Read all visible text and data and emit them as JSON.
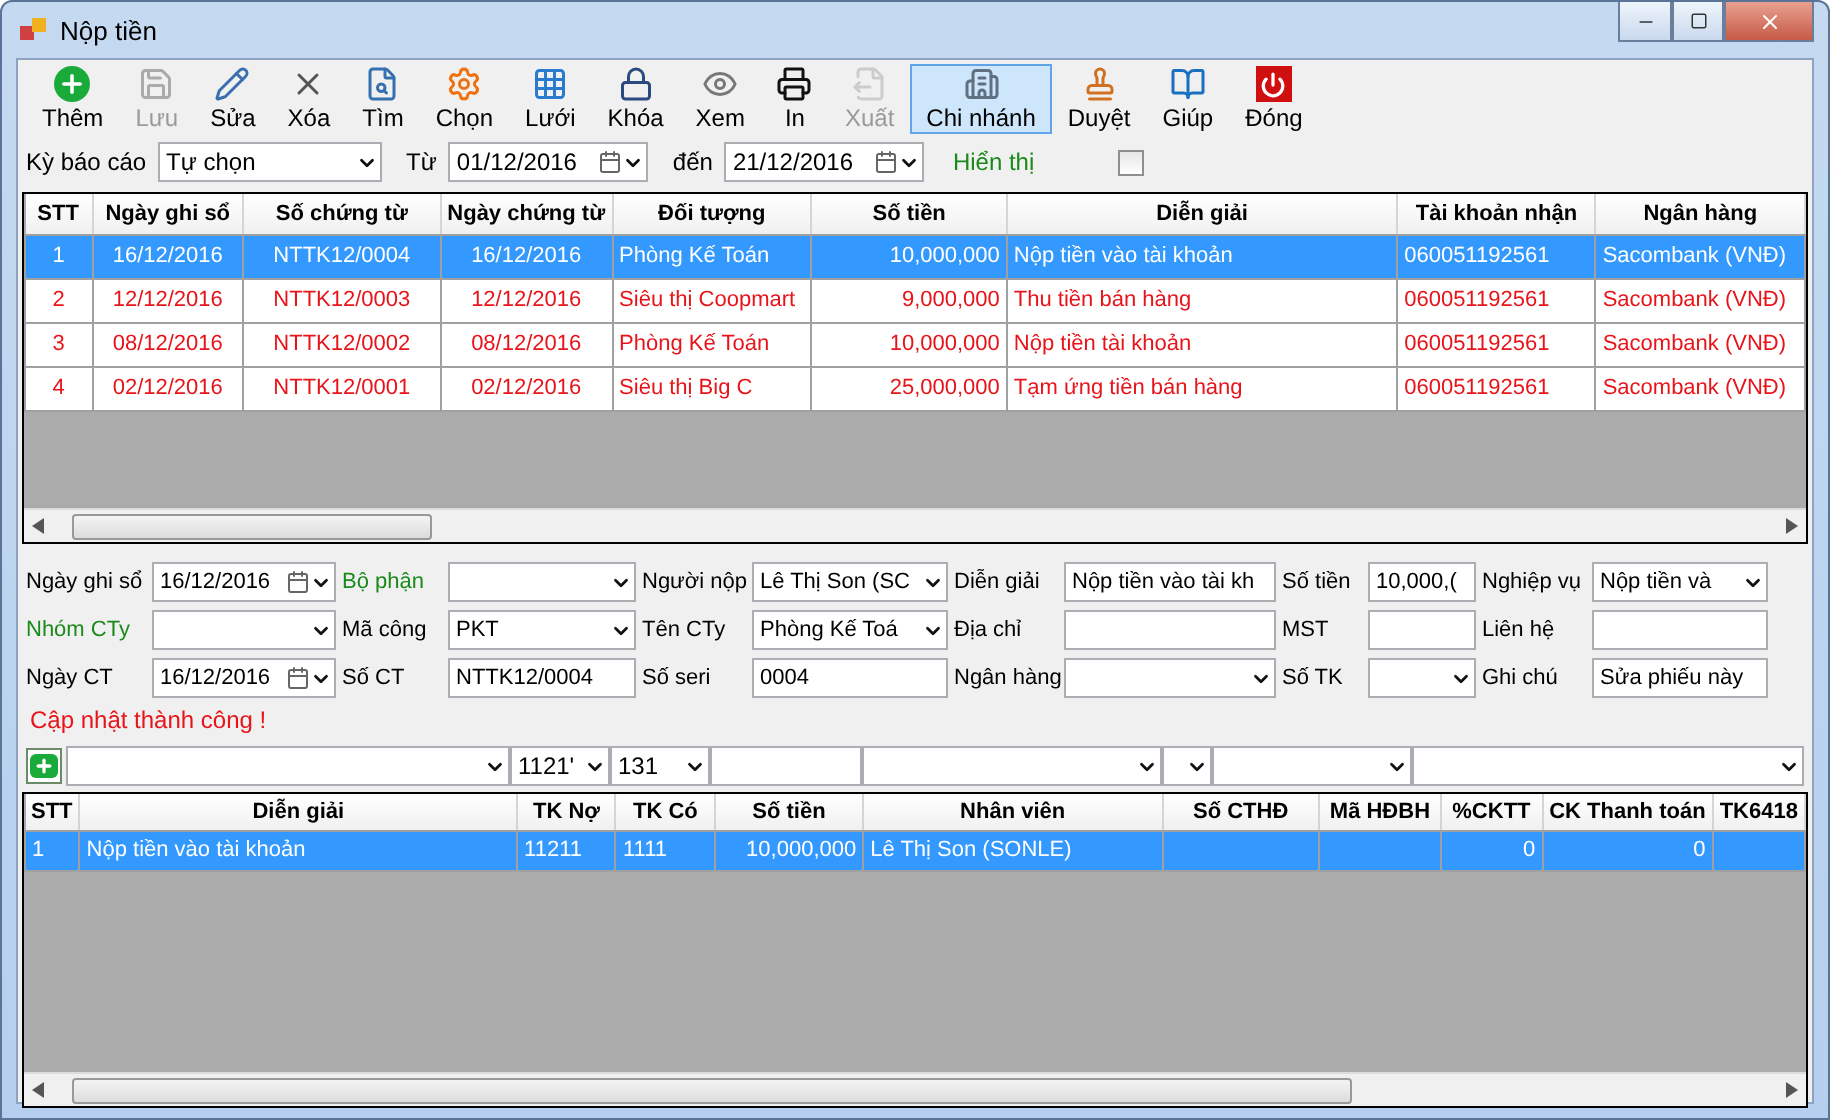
{
  "window": {
    "title": "Nộp tiền"
  },
  "toolbar": [
    {
      "label": "Thêm",
      "enabled": true,
      "selected": false
    },
    {
      "label": "Lưu",
      "enabled": false,
      "selected": false
    },
    {
      "label": "Sửa",
      "enabled": true,
      "selected": false
    },
    {
      "label": "Xóa",
      "enabled": true,
      "selected": false
    },
    {
      "label": "Tìm",
      "enabled": true,
      "selected": false
    },
    {
      "label": "Chọn",
      "enabled": true,
      "selected": false
    },
    {
      "label": "Lưới",
      "enabled": true,
      "selected": false
    },
    {
      "label": "Khóa",
      "enabled": true,
      "selected": false
    },
    {
      "label": "Xem",
      "enabled": true,
      "selected": false
    },
    {
      "label": "In",
      "enabled": true,
      "selected": false
    },
    {
      "label": "Xuất",
      "enabled": false,
      "selected": false
    },
    {
      "label": "Chi nhánh",
      "enabled": true,
      "selected": true
    },
    {
      "label": "Duyệt",
      "enabled": true,
      "selected": false
    },
    {
      "label": "Giúp",
      "enabled": true,
      "selected": false
    },
    {
      "label": "Đóng",
      "enabled": true,
      "selected": false
    }
  ],
  "filter": {
    "period_label": "Kỳ báo cáo",
    "period": "Tự chọn",
    "from_label": "Từ",
    "from": "01/12/2016",
    "to_label": "đến",
    "to": "21/12/2016",
    "show_label": "Hiển thị",
    "show_checked": false
  },
  "table": {
    "columns": [
      "STT",
      "Ngày ghi sổ",
      "Số chứng từ",
      "Ngày chứng từ",
      "Đối tượng",
      "Số tiền",
      "Diễn giải",
      "Tài khoản nhận",
      "Ngân hàng"
    ],
    "rows": [
      {
        "selected": true,
        "cells": [
          "1",
          "16/12/2016",
          "NTTK12/0004",
          "16/12/2016",
          "Phòng Kế Toán",
          "10,000,000",
          "Nộp tiền vào tài khoản",
          "060051192561",
          "Sacombank (VNĐ)"
        ]
      },
      {
        "selected": false,
        "cells": [
          "2",
          "12/12/2016",
          "NTTK12/0003",
          "12/12/2016",
          "Siêu thị Coopmart",
          "9,000,000",
          "Thu tiền bán hàng",
          "060051192561",
          "Sacombank (VNĐ)"
        ]
      },
      {
        "selected": false,
        "cells": [
          "3",
          "08/12/2016",
          "NTTK12/0002",
          "08/12/2016",
          "Phòng Kế Toán",
          "10,000,000",
          "Nộp tiền tài khoản",
          "060051192561",
          "Sacombank (VNĐ)"
        ]
      },
      {
        "selected": false,
        "cells": [
          "4",
          "02/12/2016",
          "NTTK12/0001",
          "02/12/2016",
          "Siêu thị Big C",
          "25,000,000",
          "Tạm ứng tiền bán hàng",
          "060051192561",
          "Sacombank (VNĐ)"
        ]
      }
    ]
  },
  "form": [
    [
      {
        "label": "Ngày ghi sổ",
        "linked": false,
        "kind": "date",
        "value": "16/12/2016"
      },
      {
        "label": "Bộ phận",
        "linked": true,
        "kind": "combo"
      },
      {
        "label": "Người nộp",
        "linked": false,
        "kind": "combo",
        "value": "Lê Thị Son (SC"
      },
      {
        "label": "Diễn giải",
        "linked": false,
        "kind": "text",
        "value": "Nộp tiền vào tài kh"
      },
      {
        "label": "Số tiền",
        "linked": false,
        "kind": "text",
        "value": "10,000,("
      },
      {
        "label": "Nghiệp vụ",
        "linked": false,
        "kind": "combo",
        "value": "Nộp tiền và"
      }
    ],
    [
      {
        "label": "Nhóm CTy",
        "linked": true,
        "kind": "combo"
      },
      {
        "label": "Mã công",
        "linked": false,
        "kind": "combo",
        "value": "PKT"
      },
      {
        "label": "Tên CTy",
        "linked": false,
        "kind": "combo",
        "value": "Phòng Kế Toá"
      },
      {
        "label": "Địa chỉ",
        "linked": false,
        "kind": "text"
      },
      {
        "label": "MST",
        "linked": false,
        "kind": "text"
      },
      {
        "label": "Liên hệ",
        "linked": false,
        "kind": "text"
      }
    ],
    [
      {
        "label": "Ngày CT",
        "linked": false,
        "kind": "date",
        "value": "16/12/2016"
      },
      {
        "label": "Số CT",
        "linked": false,
        "kind": "text",
        "value": "NTTK12/0004"
      },
      {
        "label": "Số seri",
        "linked": false,
        "kind": "text",
        "value": "0004"
      },
      {
        "label": "Ngân hàng",
        "linked": false,
        "kind": "combo"
      },
      {
        "label": "Số TK",
        "linked": false,
        "kind": "combo"
      },
      {
        "label": "Ghi chú",
        "linked": false,
        "kind": "text",
        "value": "Sửa phiếu này"
      }
    ]
  ],
  "status_message": "Cập nhật thành công !",
  "detail_inputs": [
    {
      "kind": "combo"
    },
    {
      "kind": "combo",
      "value": "1121'"
    },
    {
      "kind": "combo",
      "value": "131"
    },
    {
      "kind": "text"
    },
    {
      "kind": "combo"
    },
    {
      "kind": "combo"
    },
    {
      "kind": "combo"
    },
    {
      "kind": "combo"
    }
  ],
  "detail_table": {
    "columns": [
      "STT",
      "Diễn giải",
      "TK Nợ",
      "TK Có",
      "Số tiền",
      "Nhân viên",
      "Số CTHĐ",
      "Mã HĐBH",
      "%CKTT",
      "CK Thanh toán",
      "TK6418"
    ],
    "rows": [
      {
        "selected": true,
        "cells": [
          "1",
          "Nộp tiền vào tài khoản",
          "11211",
          "1111",
          "10,000,000",
          "Lê Thị Son (SONLE)",
          "",
          "",
          "0",
          "0",
          ""
        ]
      }
    ]
  }
}
